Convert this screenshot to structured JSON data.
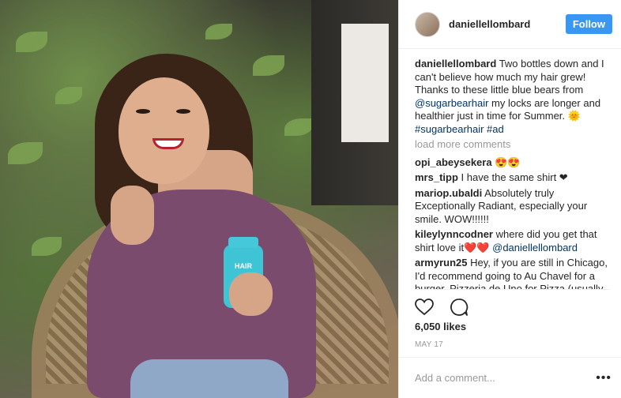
{
  "post": {
    "username": "daniellellombard",
    "follow_label": "Follow",
    "caption": {
      "user": "daniellellombard",
      "text_1": " Two bottles down and I can't believe how much my hair grew! Thanks to these little blue bears from ",
      "mention": "@sugarbearhair",
      "text_2": " my locks are longer and healthier just in time for Summer. ",
      "emoji": "🌞",
      "tags": "#sugarbearhair #ad"
    },
    "load_more": "load more comments",
    "comments": [
      {
        "user": "opi_abeysekera",
        "text": " 😍😍"
      },
      {
        "user": "mrs_tipp",
        "text": " I have the same shirt ❤"
      },
      {
        "user": "mariop.ubaldi",
        "text": " Absolutely truly Exceptionally Radiant, especially your smile. WOW!!!!!!"
      },
      {
        "user": "kileylynncodner",
        "text": " where did you get that shirt love it❤️❤️ ",
        "mention": "@daniellellombard"
      },
      {
        "user": "armyrun25",
        "text": " Hey, if you are still in Chicago, I'd recommend going to Au Chavel for a burger, Pizzeria de Uno for Pizza (usually a long wait), go to any Portillos for a Hot Dog, check out Lagunitas Brewery,"
      }
    ],
    "likes": "6,050 likes",
    "date": "MAY 17",
    "comment_placeholder": "Add a comment...",
    "more_icon": "•••",
    "bottle_label": "HAIR"
  }
}
